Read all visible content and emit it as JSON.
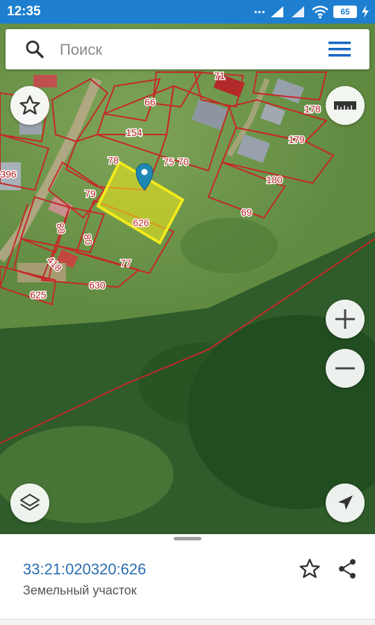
{
  "status_bar": {
    "time": "12:35",
    "dots": "...",
    "battery": "65"
  },
  "search": {
    "placeholder": "Поиск"
  },
  "map": {
    "highlight_color": "#f2ea1c",
    "boundary_color": "#c62828",
    "parcel_labels": [
      "66",
      "71",
      "178",
      "154",
      "179",
      "78",
      "75",
      "70",
      "396",
      "79",
      "180",
      "626",
      "69",
      "80",
      "80",
      "418",
      "77",
      "630",
      "625"
    ]
  },
  "sheet": {
    "cadastral_number": "33:21:020320:626",
    "type": "Земельный участок"
  },
  "icons": {
    "search": "search-icon",
    "menu": "menu-icon",
    "favorite": "star-icon",
    "ruler": "ruler-icon",
    "zoom_in": "plus-icon",
    "zoom_out": "minus-icon",
    "layers": "layers-icon",
    "locate": "navigation-arrow-icon",
    "share": "share-icon",
    "marker": "map-pin-icon"
  }
}
